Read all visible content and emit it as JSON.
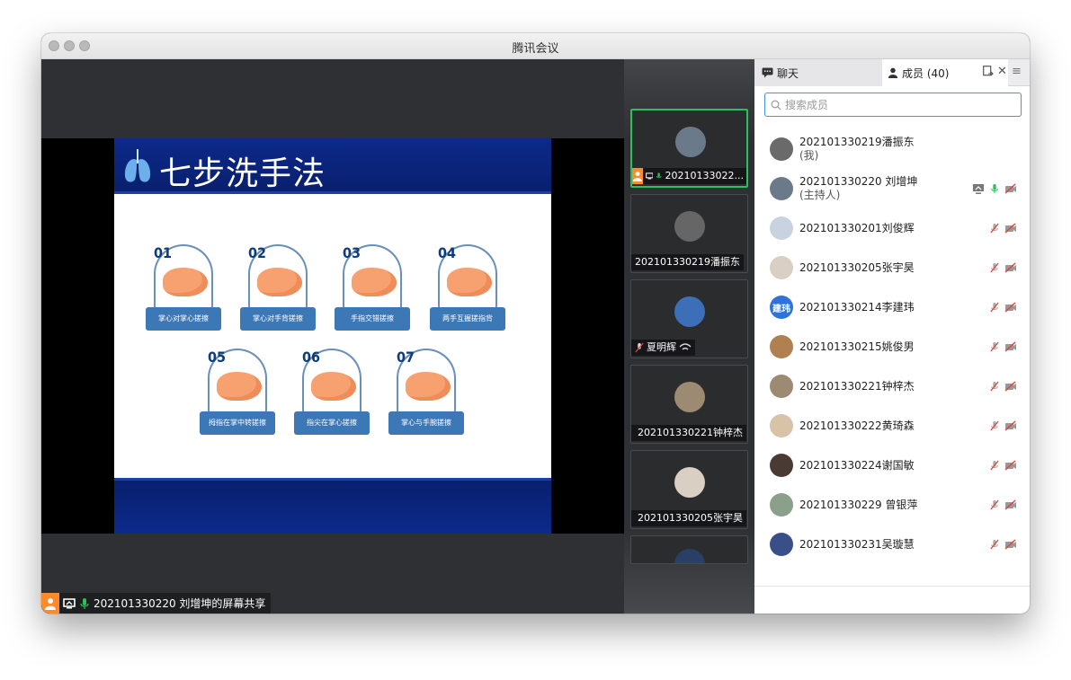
{
  "window": {
    "title": "腾讯会议"
  },
  "slide": {
    "title": "七步洗手法",
    "steps": [
      {
        "num": "01",
        "label": "掌心对掌心搓擦"
      },
      {
        "num": "02",
        "label": "掌心对手背搓擦"
      },
      {
        "num": "03",
        "label": "手指交错搓擦"
      },
      {
        "num": "04",
        "label": "两手互握搓指背"
      },
      {
        "num": "05",
        "label": "拇指在掌中转搓擦"
      },
      {
        "num": "06",
        "label": "指尖在掌心搓擦"
      },
      {
        "num": "07",
        "label": "掌心与手腕搓擦"
      }
    ]
  },
  "share_label": "202101330220 刘增坤的屏幕共享",
  "video_tiles": [
    {
      "name": "20210133022...",
      "avatar_color": "#6b7a8a"
    },
    {
      "name": "202101330219潘振东",
      "avatar_color": "#666666"
    },
    {
      "name": "夏明辉",
      "avatar_color": "#3d6fb8"
    },
    {
      "name": "202101330221钟梓杰",
      "avatar_color": "#9c8b72"
    },
    {
      "name": "202101330205张宇昊",
      "avatar_color": "#d9cfc2"
    }
  ],
  "panel": {
    "tab_chat": "聊天",
    "tab_members": "成员 (40)",
    "search_placeholder": "搜索成员",
    "members": [
      {
        "name": "202101330219潘振东",
        "sub": "(我)",
        "avatar_color": "#6a6a6a",
        "avatar_text": ""
      },
      {
        "name": "202101330220 刘增坤",
        "sub": "(主持人)",
        "avatar_color": "#6b7a8a",
        "avatar_text": ""
      },
      {
        "name": "202101330201刘俊辉",
        "sub": "",
        "avatar_color": "#c9d3e0",
        "avatar_text": ""
      },
      {
        "name": "202101330205张宇昊",
        "sub": "",
        "avatar_color": "#d9cfc2",
        "avatar_text": ""
      },
      {
        "name": "202101330214李建玮",
        "sub": "",
        "avatar_color": "#2f72d9",
        "avatar_text": "建玮"
      },
      {
        "name": "202101330215姚俊男",
        "sub": "",
        "avatar_color": "#b08050",
        "avatar_text": ""
      },
      {
        "name": "202101330221钟梓杰",
        "sub": "",
        "avatar_color": "#9c8b72",
        "avatar_text": ""
      },
      {
        "name": "202101330222黄琦森",
        "sub": "",
        "avatar_color": "#d8c2a8",
        "avatar_text": ""
      },
      {
        "name": "202101330224谢国敏",
        "sub": "",
        "avatar_color": "#4a3a34",
        "avatar_text": ""
      },
      {
        "name": "202101330229 曾银萍",
        "sub": "",
        "avatar_color": "#8aa08a",
        "avatar_text": ""
      },
      {
        "name": "202101330231吴璇慧",
        "sub": "",
        "avatar_color": "#3a4f8a",
        "avatar_text": ""
      }
    ]
  }
}
